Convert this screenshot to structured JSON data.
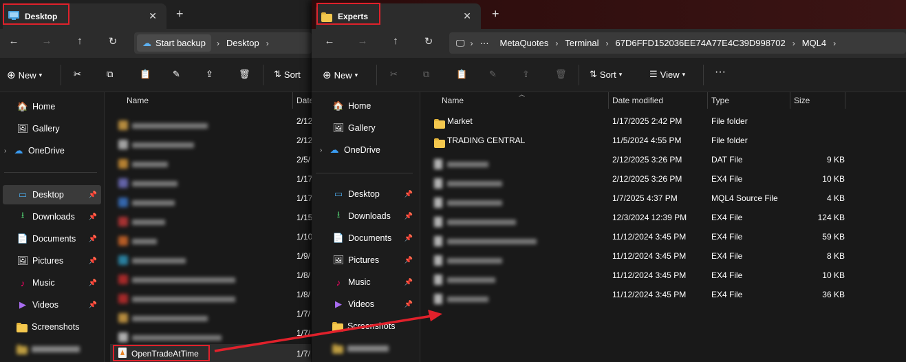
{
  "w1": {
    "tab": "Desktop",
    "backup": "Start backup",
    "crumb": "Desktop",
    "toolbar": {
      "new": "New",
      "sort": "Sort"
    },
    "cols": {
      "name": "Name",
      "date": "Date"
    },
    "nav": {
      "home": "Home",
      "gallery": "Gallery",
      "onedrive": "OneDrive",
      "desktop": "Desktop",
      "downloads": "Downloads",
      "documents": "Documents",
      "pictures": "Pictures",
      "music": "Music",
      "videos": "Videos",
      "screenshots": "Screenshots"
    },
    "rows": [
      {
        "d": "2/12"
      },
      {
        "d": "2/12"
      },
      {
        "d": "2/5/"
      },
      {
        "d": "1/17"
      },
      {
        "d": "1/17"
      },
      {
        "d": "1/15"
      },
      {
        "d": "1/10"
      },
      {
        "d": "1/9/"
      },
      {
        "d": "1/8/"
      },
      {
        "d": "1/8/"
      },
      {
        "d": "1/7/"
      },
      {
        "d": "1/7/"
      }
    ],
    "last": {
      "name": "OpenTradeAtTime",
      "d": "1/7/"
    }
  },
  "w2": {
    "tab": "Experts",
    "crumbs": [
      "MetaQuotes",
      "Terminal",
      "67D6FFD152036EE74A77E4C39D998702",
      "MQL4"
    ],
    "toolbar": {
      "new": "New",
      "sort": "Sort",
      "view": "View"
    },
    "cols": {
      "name": "Name",
      "date": "Date modified",
      "type": "Type",
      "size": "Size"
    },
    "nav": {
      "home": "Home",
      "gallery": "Gallery",
      "onedrive": "OneDrive",
      "desktop": "Desktop",
      "downloads": "Downloads",
      "documents": "Documents",
      "pictures": "Pictures",
      "music": "Music",
      "videos": "Videos",
      "screenshots": "Screenshots"
    },
    "files": [
      {
        "name": "Market",
        "date": "1/17/2025 2:42 PM",
        "type": "File folder",
        "size": ""
      },
      {
        "name": "TRADING CENTRAL",
        "date": "11/5/2024 4:55 PM",
        "type": "File folder",
        "size": ""
      },
      {
        "name": "",
        "date": "2/12/2025 3:26 PM",
        "type": "DAT File",
        "size": "9 KB"
      },
      {
        "name": "",
        "date": "2/12/2025 3:26 PM",
        "type": "EX4 File",
        "size": "10 KB"
      },
      {
        "name": "",
        "date": "1/7/2025 4:37 PM",
        "type": "MQL4 Source File",
        "size": "4 KB"
      },
      {
        "name": "",
        "date": "12/3/2024 12:39 PM",
        "type": "EX4 File",
        "size": "124 KB"
      },
      {
        "name": "",
        "date": "11/12/2024 3:45 PM",
        "type": "EX4 File",
        "size": "59 KB"
      },
      {
        "name": "",
        "date": "11/12/2024 3:45 PM",
        "type": "EX4 File",
        "size": "8 KB"
      },
      {
        "name": "",
        "date": "11/12/2024 3:45 PM",
        "type": "EX4 File",
        "size": "10 KB"
      },
      {
        "name": "",
        "date": "11/12/2024 3:45 PM",
        "type": "EX4 File",
        "size": "36 KB"
      }
    ]
  },
  "colors": {
    "highlight": "#e0212b",
    "folder": "#f4c84e"
  }
}
